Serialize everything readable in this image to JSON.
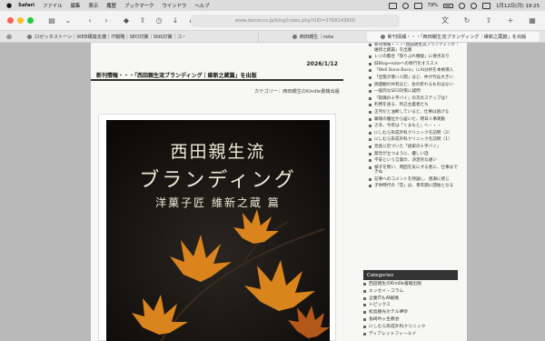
{
  "menubar": {
    "apple": "",
    "app": "Safari",
    "items": [
      "ファイル",
      "編集",
      "表示",
      "履歴",
      "ブックマーク",
      "ウインドウ",
      "ヘルプ"
    ],
    "battery": "79%",
    "datetime": "1月12日(月) 19:25"
  },
  "toolbar": {
    "url": "www.danot.co.jp/blog/index.php?UID=1768143600"
  },
  "tabs": [
    {
      "label": "ロゼッタストーン｜WEB構築支援｜IT戦略｜SEO対策｜SNS対策｜コ・"
    },
    {
      "label": "西田親生｜note"
    },
    {
      "label": "新刊情報・・・「西田親生流ブランディング｜維新之蔵篇」を出版"
    }
  ],
  "post": {
    "date": "2026/1/12",
    "title": "新刊情報・・・「西田親生流ブランディング｜維新之蔵篇」を出版",
    "category": "カテゴリー：西田親生のKindle書籍出版"
  },
  "cover": {
    "line1": "西田親生流",
    "line2": "ブランディング",
    "line3": "洋菓子匠 維新之蔵 篇"
  },
  "sidebar": {
    "recent": [
      "新刊情報・・・「西田親生流ブランディング｜維新之蔵篇」を出版",
      "レジの都合「怒りぶれ機能」に要点あり",
      "旧Blog⇒noteへの移行をオススメ",
      "「Well Done Basic」にAI分析を本格導入",
      "「出張が悪い人間」ほど、仲が代は大きい",
      "価値観の共有ほど、会の折れるものはない",
      "一般的なSEO対策に疑問",
      "「就職の十字バイ」の次のステップは？",
      "利用を語る、利己主義者たち",
      "正月だと油断していると、仕事は逃げる",
      "職場の優位から届いた、明日人事異動",
      "さあ、今年は「くまもと」へ・・・",
      "にしむら形成外科クリニックを訪問（2）",
      "にしむら形成外科クリニックを訪問（1）",
      "見逃に近づいた「語家の十字バイ」",
      "発見が立つように、優しい話",
      "不安という言葉の、決定的な違い",
      "様子を問い、周囲を気にする者に、仕事はできぬ",
      "記事へのコメントを持論し、感謝に感じ",
      "子供時代の「恋」は、青年期に開始となる"
    ],
    "categories_title": "Categories",
    "categories": [
      "西田親生のKindle書籍出版",
      "エッセイ・コラム",
      "企業ITもAI戦略",
      "トピックス",
      "松島観光ホテル岬亭",
      "長崎吟ヶ生教会",
      "にしむら形成外科クリニック",
      "ディアレットフィールド"
    ]
  }
}
